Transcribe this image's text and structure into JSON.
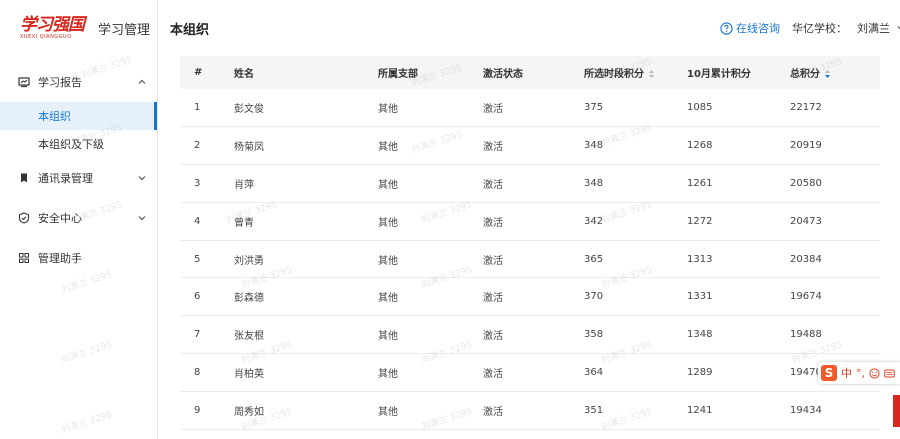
{
  "sidebar": {
    "logo_text": "学习强国",
    "logo_sub": "XUEXI QIANGGUO",
    "app_title": "学习管理",
    "menu": [
      {
        "label": "学习报告",
        "icon": "report-icon"
      },
      {
        "label": "通讯录管理",
        "icon": "bookmark-icon"
      },
      {
        "label": "安全中心",
        "icon": "shield-icon"
      },
      {
        "label": "管理助手",
        "icon": "grid-icon"
      }
    ],
    "submenu": [
      {
        "label": "本组织"
      },
      {
        "label": "本组织及下级"
      }
    ]
  },
  "header": {
    "title": "本组织",
    "consult": "在线咨询",
    "school": "华亿学校：",
    "user": "刘满兰"
  },
  "table": {
    "headers": [
      "#",
      "姓名",
      "所属支部",
      "激活状态",
      "所选时段积分",
      "10月累计积分",
      "总积分"
    ],
    "rows": [
      [
        "1",
        "彭文俊",
        "其他",
        "激活",
        "375",
        "1085",
        "22172"
      ],
      [
        "2",
        "杨菊凤",
        "其他",
        "激活",
        "348",
        "1268",
        "20919"
      ],
      [
        "3",
        "肖萍",
        "其他",
        "激活",
        "348",
        "1261",
        "20580"
      ],
      [
        "4",
        "曾青",
        "其他",
        "激活",
        "342",
        "1272",
        "20473"
      ],
      [
        "5",
        "刘洪勇",
        "其他",
        "激活",
        "365",
        "1313",
        "20384"
      ],
      [
        "6",
        "彭森德",
        "其他",
        "激活",
        "370",
        "1331",
        "19674"
      ],
      [
        "7",
        "张友根",
        "其他",
        "激活",
        "358",
        "1348",
        "19488"
      ],
      [
        "8",
        "肖柏英",
        "其他",
        "激活",
        "364",
        "1289",
        "19470"
      ],
      [
        "9",
        "周秀如",
        "其他",
        "激活",
        "351",
        "1241",
        "19434"
      ]
    ]
  },
  "watermark": "刘满兰 3295",
  "ime": {
    "mode": "中",
    "punct": "°,"
  },
  "colors": {
    "accent": "#1677d2",
    "brand": "#d7261d"
  }
}
